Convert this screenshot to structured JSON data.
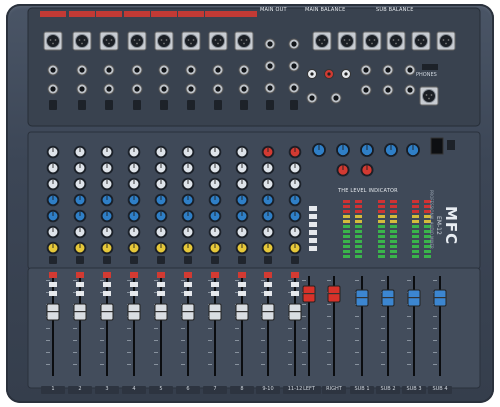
{
  "device": {
    "brand": "MFC",
    "model": "EM-12",
    "tagline": "PROFESSIONAL AUDIO MIXER"
  },
  "header_labels": {
    "main_out": "MAIN OUT",
    "main_balance": "MAIN BALANCE",
    "sub_balance": "SUB BALANCE",
    "phones": "PHONES",
    "level_indicator": "THE LEVEL INDICATOR"
  },
  "channels": [
    "1",
    "2",
    "3",
    "4",
    "5",
    "6",
    "7",
    "8",
    "9-10",
    "11-12",
    "LEFT",
    "RIGHT",
    "SUB 1",
    "SUB 2",
    "SUB 3",
    "SUB 4"
  ],
  "colors": {
    "panel": "#3c4656",
    "knob_top": "#dfe4ea",
    "knob_blue": "#2f7fc7",
    "knob_yellow": "#e6c83a",
    "knob_red": "#d23a32",
    "fader_cap": "#d9dde2",
    "fader_red": "#d8322a",
    "fader_blue": "#3c86d0",
    "led_green": "#3ac04a",
    "led_red": "#e03030"
  }
}
